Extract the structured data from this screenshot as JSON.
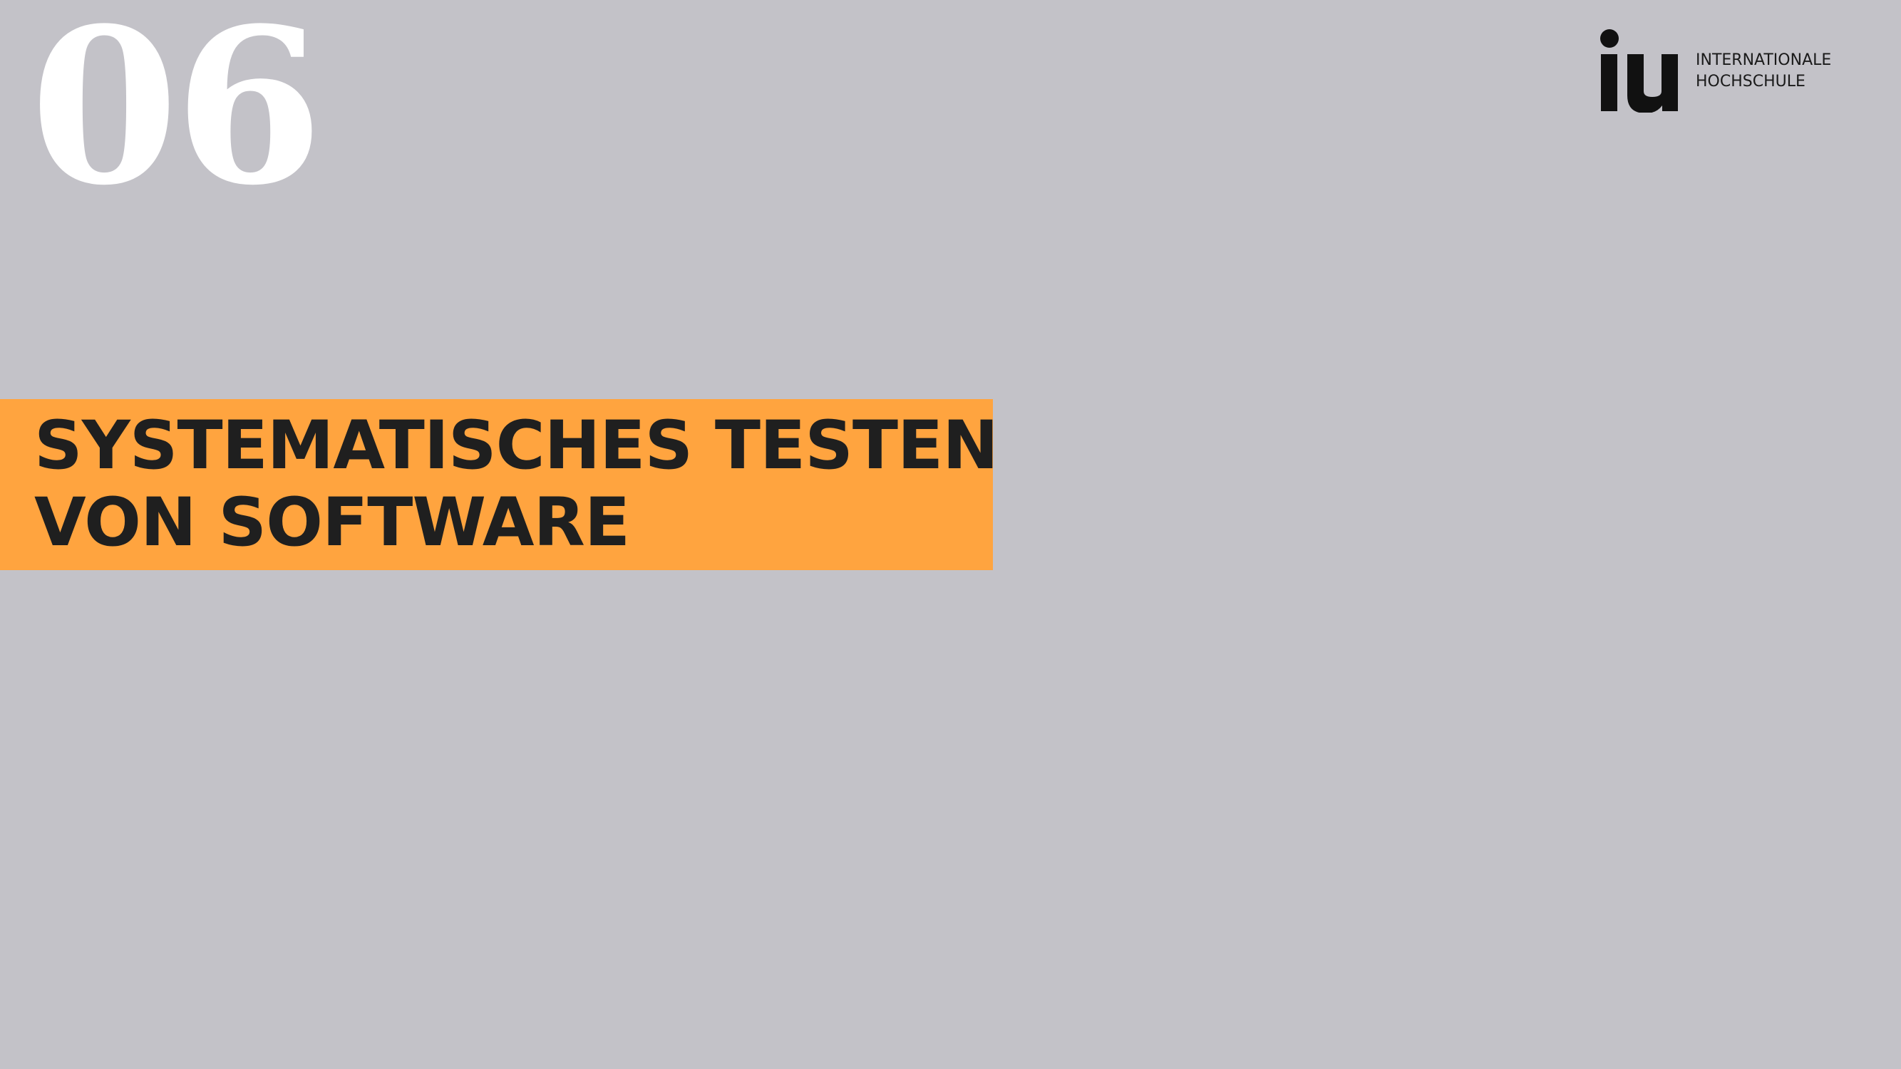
{
  "slide": {
    "chapter_number": "06",
    "title_line1": "SYSTEMATISCHES TESTEN",
    "title_line2": "VON SOFTWARE"
  },
  "logo": {
    "mark": "iu",
    "line1": "INTERNATIONALE",
    "line2": "HOCHSCHULE",
    "icon": "iu-logo-icon"
  },
  "colors": {
    "background": "#c3c2c8",
    "accent": "#ffa43f",
    "title_text": "#1f1f1f",
    "chapter_number": "#ffffff"
  }
}
